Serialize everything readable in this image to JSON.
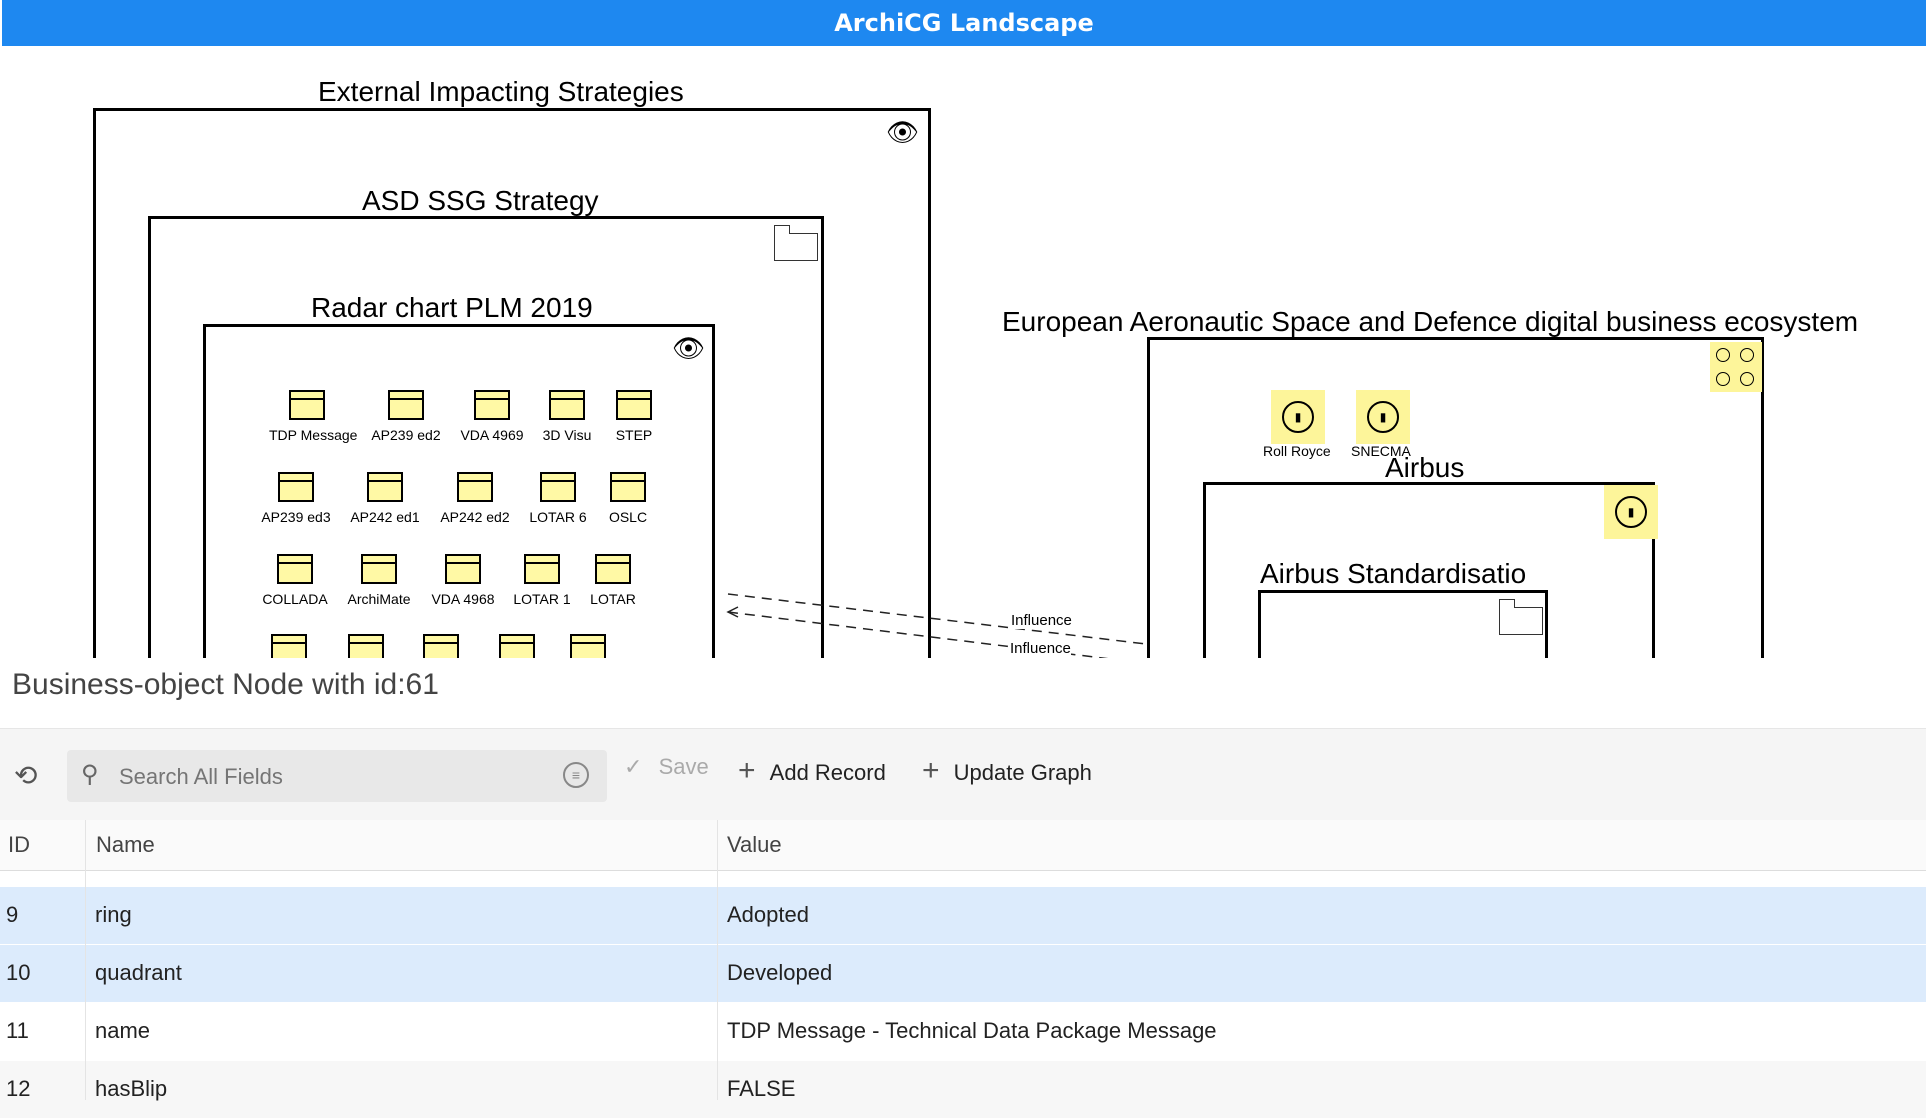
{
  "app": {
    "title": "ArchiCG Landscape"
  },
  "diagram": {
    "groups": {
      "external": "External Impacting Strategies",
      "asd": "ASD SSG Strategy",
      "radar": "Radar chart PLM 2019",
      "european": "European Aeronautic Space and Defence digital business ecosystem",
      "airbus": "Airbus",
      "airbus_std": "Airbus Standardisatio"
    },
    "objects": {
      "r1": [
        "TDP Message",
        "AP239 ed2",
        "VDA 4969",
        "3D Visu",
        "STEP"
      ],
      "r2": [
        "AP239 ed3",
        "AP242 ed1",
        "AP242 ed2",
        "LOTAR 6",
        "OSLC"
      ],
      "r3": [
        "COLLADA",
        "ArchiMate",
        "VDA 4968",
        "LOTAR 1",
        "LOTAR"
      ]
    },
    "actors": {
      "a1": "Roll Royce",
      "a2": "SNECMA"
    },
    "relations": {
      "rel1": "Influence",
      "rel2": "Influence"
    }
  },
  "panel": {
    "title": "Business-object Node with id:61",
    "toolbar": {
      "search_placeholder": "Search All Fields",
      "save": "Save",
      "add_record": "Add Record",
      "update_graph": "Update Graph"
    },
    "columns": {
      "id": "ID",
      "name": "Name",
      "value": "Value"
    },
    "rows": [
      {
        "id": "9",
        "name": "ring",
        "value": "Adopted"
      },
      {
        "id": "10",
        "name": "quadrant",
        "value": "Developed"
      },
      {
        "id": "11",
        "name": "name",
        "value": "TDP Message - Technical Data Package Message"
      },
      {
        "id": "12",
        "name": "hasBlip",
        "value": "FALSE"
      }
    ]
  }
}
